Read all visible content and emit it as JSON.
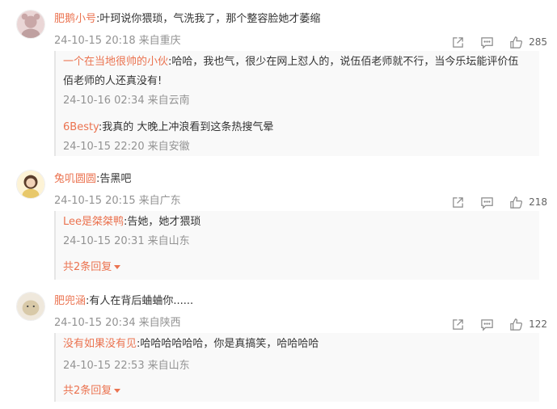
{
  "comments": [
    {
      "user": "肥鹅小号",
      "text": ":叶珂说你猥琐，气洗我了，那个整容脸她才萎缩",
      "date": "24-10-15 20:18",
      "location": "来自重庆",
      "likes": "285",
      "avatar_color": "#c9a7a7",
      "replies": [
        {
          "user": "一个在当地很帅的小伙",
          "text": ":哈哈，我也气，很少在网上怼人的，说伍佰老师就不行，当今乐坛能评价伍佰老师的人还真没有!",
          "date": "24-10-16 02:34",
          "location": "来自云南"
        },
        {
          "user": "6Besty",
          "text": ":我真的 大晚上冲浪看到这条热搜气晕",
          "date": "24-10-15 22:20",
          "location": "来自安徽"
        }
      ]
    },
    {
      "user": "兔叽圆圆",
      "text": ":告黑吧",
      "date": "24-10-15 20:15",
      "location": "来自广东",
      "likes": "218",
      "avatar_color": "#e8c86a",
      "replies": [
        {
          "user": "Lee是桀桀鸭",
          "text": ":告她，她才猥琐",
          "date": "24-10-15 20:31",
          "location": "来自山东"
        }
      ],
      "more": "共2条回复"
    },
    {
      "user": "肥兜涵",
      "text": ":有人在背后蛐蛐你......",
      "date": "24-10-15 20:34",
      "location": "来自陕西",
      "likes": "122",
      "avatar_color": "#d8c9a8",
      "replies": [
        {
          "user": "没有如果没有见",
          "text": ":哈哈哈哈哈哈，你是真搞笑，哈哈哈哈",
          "date": "24-10-15 22:53",
          "location": "来自山东"
        }
      ],
      "more": "共2条回复"
    }
  ],
  "icons": {
    "share": "share-icon",
    "comment": "comment-icon",
    "like": "thumbs-up-icon"
  },
  "colors": {
    "username": "#eb7350",
    "meta": "#939393"
  }
}
